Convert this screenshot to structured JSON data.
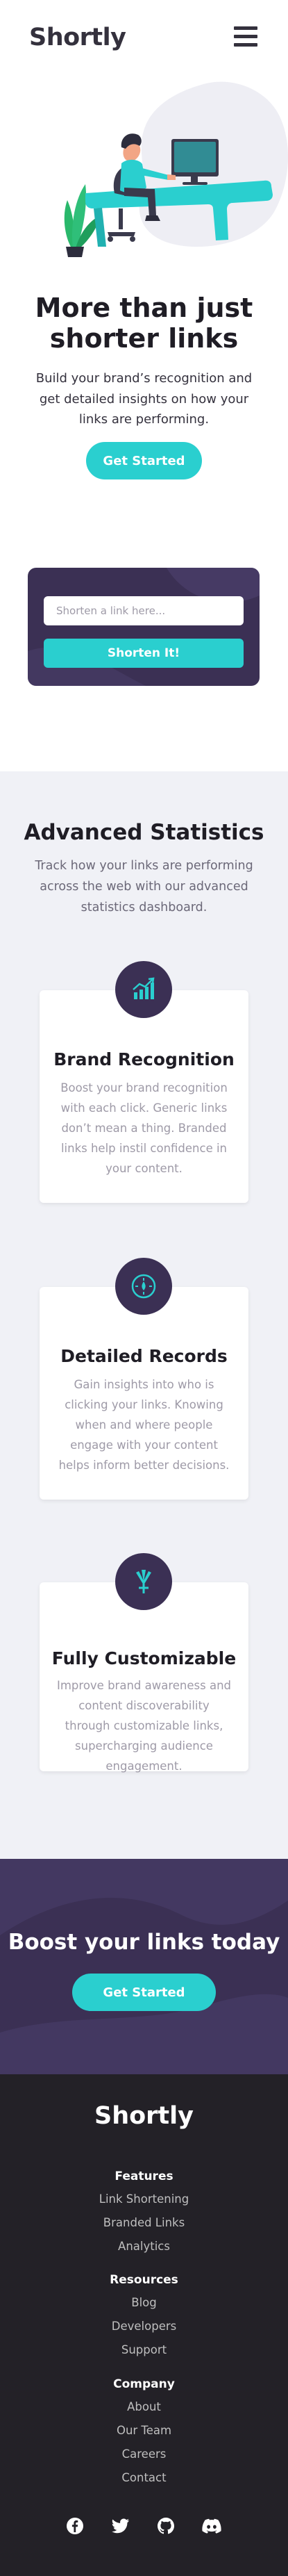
{
  "header": {
    "logo": "Shortly",
    "menu_icon": "hamburger-menu-icon"
  },
  "hero": {
    "illustration": "person-working-at-desk-illustration",
    "title": "More than just shorter links",
    "description": "Build your brand’s recognition and get detailed insights on how your links are performing.",
    "cta_label": "Get Started"
  },
  "shorten": {
    "placeholder": "Shorten a link here...",
    "button_label": "Shorten It!"
  },
  "statistics": {
    "title": "Advanced Statistics",
    "description": "Track how your links are performing across the web with our advanced statistics dashboard.",
    "cards": [
      {
        "icon": "brand-recognition-icon",
        "title": "Brand Recognition",
        "text": "Boost your brand recognition with each click. Generic links don’t mean a thing. Branded links help instil confidence in your content."
      },
      {
        "icon": "detailed-records-icon",
        "title": "Detailed Records",
        "text": "Gain insights into who is clicking your links. Knowing when and where people engage with your content helps inform better decisions."
      },
      {
        "icon": "fully-customizable-icon",
        "title": "Fully Customizable",
        "text": "Improve brand awareness and content discoverability through customizable links, supercharging audience engagement."
      }
    ]
  },
  "boost": {
    "title": "Boost your links today",
    "cta_label": "Get Started"
  },
  "footer": {
    "logo": "Shortly",
    "columns": [
      {
        "heading": "Features",
        "links": [
          "Link Shortening",
          "Branded Links",
          "Analytics"
        ]
      },
      {
        "heading": "Resources",
        "links": [
          "Blog",
          "Developers",
          "Support"
        ]
      },
      {
        "heading": "Company",
        "links": [
          "About",
          "Our Team",
          "Careers",
          "Contact"
        ]
      }
    ],
    "social": [
      "facebook-icon",
      "twitter-icon",
      "github-icon",
      "discord-icon"
    ]
  },
  "colors": {
    "accent": "#2acfcf",
    "dark_violet": "#3b3054",
    "very_dark": "#232127",
    "light_bg": "#f0f1f6",
    "text_dark": "#34313d",
    "text_gray": "#9e9aa7"
  }
}
